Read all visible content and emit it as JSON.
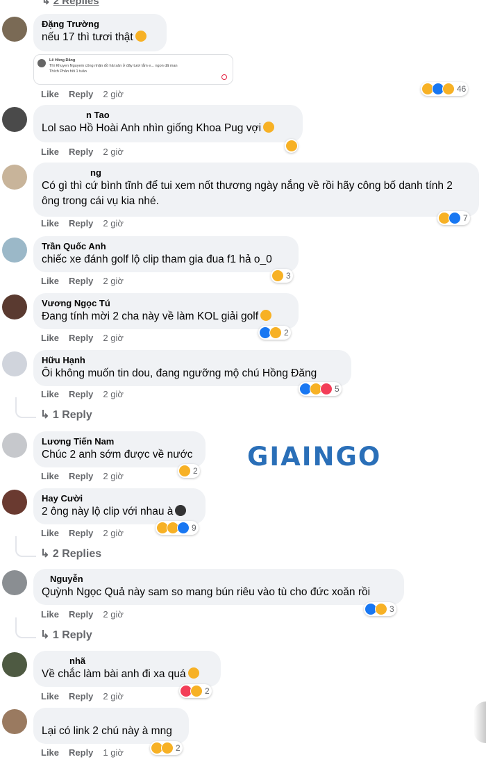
{
  "top_replies": {
    "icon": "reply-arrow-icon",
    "label": "2 Replies"
  },
  "watermark": "GIAINGO",
  "embed": {
    "line1": "Lê Hồng Đăng",
    "line2": "Thì Khuyen Nguyem công nhận đồ hải sản ở đây tươi lắm e... ngon dã man",
    "line3": "Thích   Phản hồi   1 tuần"
  },
  "actions": {
    "like": "Like",
    "reply": "Reply"
  },
  "comments": [
    {
      "author": "Đặng Trường",
      "text": "nếu 17 thì tươi thật",
      "time": "2 giờ",
      "reactions": [
        "haha",
        "like",
        "sad"
      ],
      "count": "46"
    },
    {
      "author": "n Tao",
      "text": "Lol sao Hồ Hoài Anh nhìn giống Khoa Pug vợi",
      "time": "2 giờ",
      "reactions": [
        "haha"
      ],
      "count": ""
    },
    {
      "author": "ng",
      "text": "Có gì thì cứ bình tĩnh để tui xem nốt thương ngày nắng về rồi hãy công bố danh tính 2 ông trong cái vụ kia nhé.",
      "time": "2 giờ",
      "reactions": [
        "haha",
        "like"
      ],
      "count": "7"
    },
    {
      "author": "Trần Quốc Anh",
      "text": "chiếc xe đánh golf lộ clip tham gia đua f1 hả o_0",
      "time": "2 giờ",
      "reactions": [
        "haha"
      ],
      "count": "3"
    },
    {
      "author": "Vương Ngọc Tú",
      "text": "Đang tính mời 2 cha này về làm KOL giải golf",
      "time": "2 giờ",
      "reactions": [
        "like",
        "haha"
      ],
      "count": "2"
    },
    {
      "author": "Hữu Hạnh",
      "text": "Ôi không muốn tin dou, đang ngưỡng mộ chú Hồng Đăng",
      "time": "2 giờ",
      "reactions": [
        "like",
        "haha",
        "love"
      ],
      "count": "5",
      "replies": "1 Reply"
    },
    {
      "author": "Lương Tiến Nam",
      "text": "Chúc 2 anh sớm được về nước",
      "time": "2 giờ",
      "reactions": [
        "haha"
      ],
      "count": "2"
    },
    {
      "author": "Hay Cười",
      "text": "2 ông này lộ clip với nhau à",
      "time": "2 giờ",
      "reactions": [
        "haha",
        "sad",
        "like"
      ],
      "count": "9",
      "replies": "2 Replies"
    },
    {
      "author": "Nguyễn",
      "text": "Quỳnh Ngọc Quả này sam so mang bún riêu vào tù cho đức xoăn rồi",
      "time": "2 giờ",
      "reactions": [
        "like",
        "sad"
      ],
      "count": "3",
      "replies": "1 Reply"
    },
    {
      "author": "nhã",
      "text": "Về chắc làm bài anh đi xa quá",
      "time": "2 giờ",
      "reactions": [
        "love",
        "haha"
      ],
      "count": "2"
    },
    {
      "author": "",
      "text": "Lại có link 2 chú này à mng",
      "time": "1 giờ",
      "reactions": [
        "haha",
        "sad"
      ],
      "count": "2"
    }
  ]
}
